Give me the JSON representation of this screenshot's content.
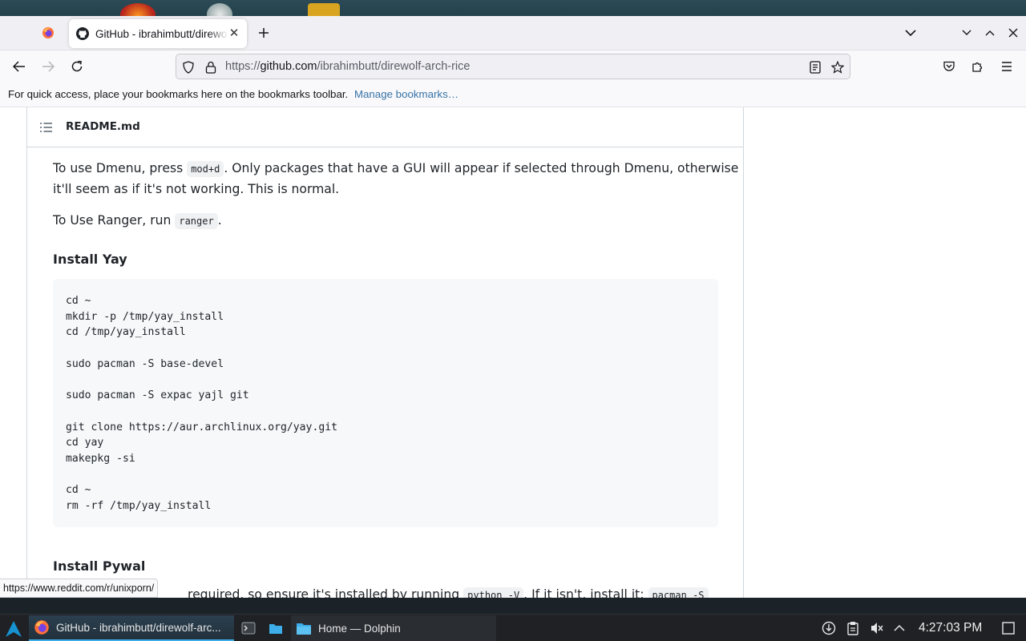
{
  "browser": {
    "active_tab_title": "GitHub - ibrahimbutt/direwolf-arch-rice",
    "tab_close_glyph": "✕",
    "url_prefix": "https://",
    "url_host": "github.com",
    "url_path": "/ibrahimbutt/direwolf-arch-rice",
    "bookmarks_message": "For quick access, place your bookmarks here on the bookmarks toolbar.",
    "bookmarks_link": "Manage bookmarks…",
    "status_link": "https://www.reddit.com/r/unixporn/"
  },
  "readme": {
    "filename": "README.md",
    "dmenu_text_1": "To use Dmenu, press",
    "dmenu_code": "mod+d",
    "dmenu_text_2": ". Only packages that have a GUI will appear if selected through Dmenu, otherwise",
    "dmenu_text_3": "it'll seem as if it's not working. This is normal.",
    "ranger_text_1": "To Use Ranger, run",
    "ranger_code": "ranger",
    "ranger_text_2": ".",
    "heading_yay": "Install Yay",
    "yay_code": "cd ~\nmkdir -p /tmp/yay_install\ncd /tmp/yay_install\n\nsudo pacman -S base-devel\n\nsudo pacman -S expac yajl git\n\ngit clone https://aur.archlinux.org/yay.git\ncd yay\nmakepkg -si\n\ncd ~\nrm -rf /tmp/yay_install",
    "heading_pywal": "Install Pywal",
    "pywal_text_1": "required, so ensure it's installed by running",
    "pywal_code_1": "python -V",
    "pywal_text_2": ". If it isn't, install it:",
    "pywal_code_2": "pacman -S"
  },
  "taskbar": {
    "firefox_task": "GitHub - ibrahimbutt/direwolf-arc...",
    "dolphin_task": "Home — Dolphin",
    "clock": "4:27:03 PM"
  },
  "colors": {
    "accent": "#3daee9",
    "link": "#3873a6",
    "text": "#1f2328"
  }
}
